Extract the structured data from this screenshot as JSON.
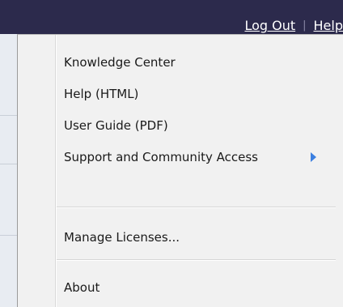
{
  "header": {
    "logout_label": "Log Out",
    "separator": "|",
    "help_label": "Help"
  },
  "menu": {
    "items": [
      {
        "label": "Knowledge Center",
        "has_submenu": false
      },
      {
        "label": "Help (HTML)",
        "has_submenu": false
      },
      {
        "label": "User Guide (PDF)",
        "has_submenu": false
      },
      {
        "label": "Support and Community Access",
        "has_submenu": true
      },
      {
        "label": "Manage Licenses...",
        "has_submenu": false
      },
      {
        "label": "About",
        "has_submenu": false
      }
    ]
  },
  "colors": {
    "header_bg": "#2c2a4c",
    "menu_bg": "#f1f1f1",
    "submenu_arrow": "#3b7fe0"
  }
}
